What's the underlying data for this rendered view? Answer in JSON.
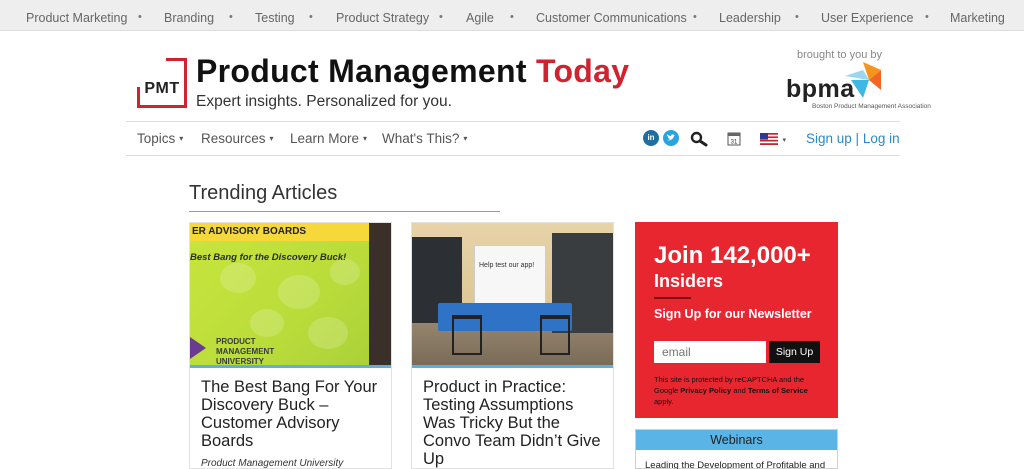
{
  "topbar": {
    "tags": [
      "Product Marketing",
      "Branding",
      "Testing",
      "Product Strategy",
      "Agile",
      "Customer Communications",
      "Leadership",
      "User Experience",
      "Marketing"
    ],
    "separator": "•"
  },
  "header": {
    "logo_text": "PMT",
    "title_main": "Product Management ",
    "title_accent": "Today",
    "tagline": "Expert insights. Personalized for you.",
    "brought_by": "brought to you by",
    "partner_logo": "bpma",
    "partner_name": "Boston Product Management Association"
  },
  "nav": {
    "menus": [
      "Topics",
      "Resources",
      "Learn More",
      "What's This?"
    ],
    "caret": "▾",
    "social": [
      "linkedin-icon",
      "twitter-icon"
    ],
    "tools": [
      "search-icon",
      "calendar-icon",
      "us-flag-icon"
    ],
    "calendar_day": "31",
    "sign_up": "Sign up",
    "link_sep": " | ",
    "log_in": "Log in"
  },
  "trending": {
    "heading": "Trending Articles",
    "articles": [
      {
        "title": "The Best Bang For Your Discovery Buck – Customer Advisory Boards",
        "author": "Product Management University",
        "image_band": "ER ADVISORY BOARDS",
        "image_sub": "Best Bang for the Discovery Buck!",
        "image_brand": "PRODUCT MANAGEMENT UNIVERSITY"
      },
      {
        "title": "Product in Practice: Testing Assumptions Was Tricky But the Convo Team Didn’t Give Up",
        "author": "",
        "image_board": "Help test our app!"
      }
    ]
  },
  "newsletter": {
    "join_prefix": "Join ",
    "join_count": "142,000+",
    "insiders": "Insiders",
    "signup_heading": "Sign Up for our Newsletter",
    "email_placeholder": "email",
    "button": "Sign Up",
    "legal_pre": "This site is protected by reCAPTCHA and the Google ",
    "privacy": "Privacy Policy",
    "legal_and": " and ",
    "terms": "Terms of Service",
    "legal_post": " apply."
  },
  "webinars": {
    "heading": "Webinars",
    "first_item": "Leading the Development of Profitable and"
  },
  "colors": {
    "brand_red": "#d0232f",
    "newsletter_red": "#e8262f",
    "link_blue": "#2a8ac4",
    "accent_blue": "#5ab4e6"
  }
}
